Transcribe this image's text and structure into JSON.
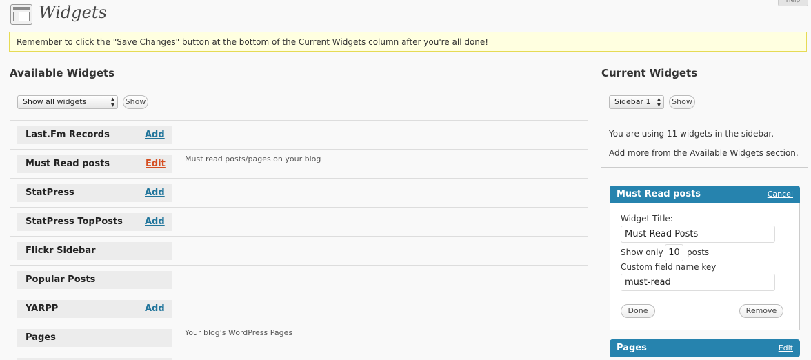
{
  "header": {
    "title": "Widgets",
    "help": "Help"
  },
  "notice": "Remember to click the \"Save Changes\" button at the bottom of the Current Widgets column after you're all done!",
  "available": {
    "heading": "Available Widgets",
    "filter_value": "Show all widgets",
    "show_label": "Show",
    "widgets": [
      {
        "name": "Last.Fm Records",
        "action": "Add",
        "description": ""
      },
      {
        "name": "Must Read posts",
        "action": "Edit",
        "description": "Must read posts/pages on your blog"
      },
      {
        "name": "StatPress",
        "action": "Add",
        "description": ""
      },
      {
        "name": "StatPress TopPosts",
        "action": "Add",
        "description": ""
      },
      {
        "name": "Flickr Sidebar",
        "action": "",
        "description": ""
      },
      {
        "name": "Popular Posts",
        "action": "",
        "description": ""
      },
      {
        "name": "YARPP",
        "action": "Add",
        "description": ""
      },
      {
        "name": "Pages",
        "action": "",
        "description": "Your blog's WordPress Pages"
      }
    ]
  },
  "current": {
    "heading": "Current Widgets",
    "sidebar_value": "Sidebar 1",
    "show_label": "Show",
    "info_line1": "You are using 11 widgets in the sidebar.",
    "info_line2": "Add more from the Available Widgets section.",
    "open_widget": {
      "title": "Must Read posts",
      "cancel": "Cancel",
      "title_label": "Widget Title:",
      "title_value": "Must Read Posts",
      "show_only_label": "Show only",
      "show_only_value": "10",
      "posts_label": "posts",
      "key_label": "Custom field name key",
      "key_value": "must-read",
      "done": "Done",
      "remove": "Remove"
    },
    "next_widget": {
      "title": "Pages",
      "edit": "Edit"
    }
  },
  "colors": {
    "add_link": "#21759b",
    "edit_link": "#d54e21",
    "titlebar": "#2683ae",
    "notice_bg": "#ffffe0"
  }
}
